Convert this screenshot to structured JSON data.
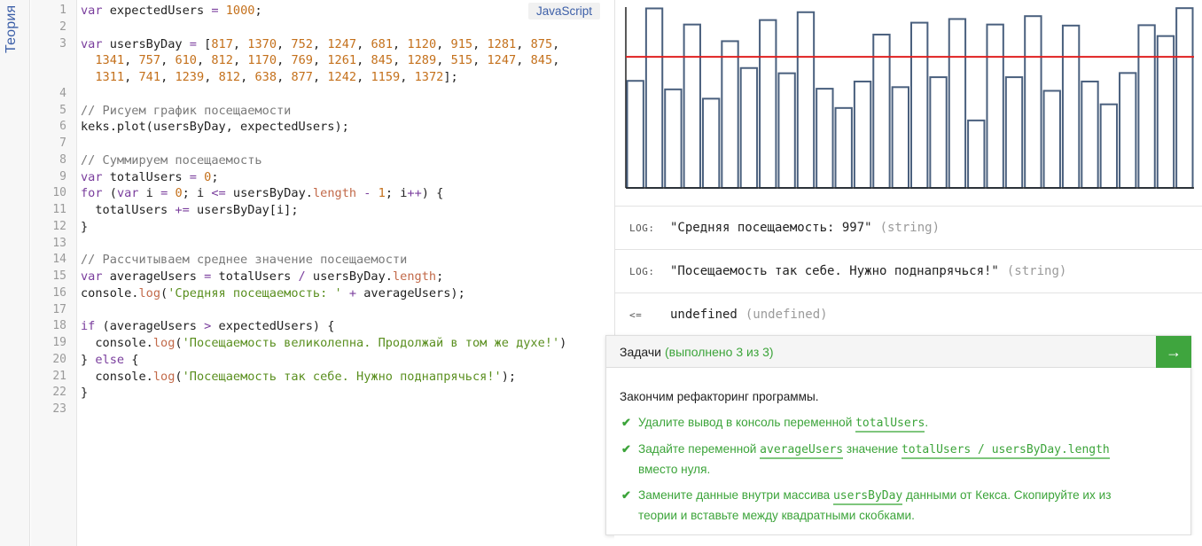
{
  "sidebar": {
    "theory_label": "Теория"
  },
  "editor": {
    "language": "JavaScript",
    "lines": [
      [
        [
          "kw",
          "var"
        ],
        [
          "",
          " expectedUsers "
        ],
        [
          "op",
          "="
        ],
        [
          "",
          " "
        ],
        [
          "num",
          "1000"
        ],
        [
          "",
          ";"
        ]
      ],
      [],
      [
        [
          "kw",
          "var"
        ],
        [
          "",
          " usersByDay "
        ],
        [
          "op",
          "="
        ],
        [
          "",
          " ["
        ],
        [
          "num",
          "817"
        ],
        [
          "",
          ", "
        ],
        [
          "num",
          "1370"
        ],
        [
          "",
          ", "
        ],
        [
          "num",
          "752"
        ],
        [
          "",
          ", "
        ],
        [
          "num",
          "1247"
        ],
        [
          "",
          ", "
        ],
        [
          "num",
          "681"
        ],
        [
          "",
          ", "
        ],
        [
          "num",
          "1120"
        ],
        [
          "",
          ", "
        ],
        [
          "num",
          "915"
        ],
        [
          "",
          ", "
        ],
        [
          "num",
          "1281"
        ],
        [
          "",
          ", "
        ],
        [
          "num",
          "875"
        ],
        [
          "",
          ","
        ]
      ],
      [
        [
          "",
          "  "
        ],
        [
          "num",
          "1341"
        ],
        [
          "",
          ", "
        ],
        [
          "num",
          "757"
        ],
        [
          "",
          ", "
        ],
        [
          "num",
          "610"
        ],
        [
          "",
          ", "
        ],
        [
          "num",
          "812"
        ],
        [
          "",
          ", "
        ],
        [
          "num",
          "1170"
        ],
        [
          "",
          ", "
        ],
        [
          "num",
          "769"
        ],
        [
          "",
          ", "
        ],
        [
          "num",
          "1261"
        ],
        [
          "",
          ", "
        ],
        [
          "num",
          "845"
        ],
        [
          "",
          ", "
        ],
        [
          "num",
          "1289"
        ],
        [
          "",
          ", "
        ],
        [
          "num",
          "515"
        ],
        [
          "",
          ", "
        ],
        [
          "num",
          "1247"
        ],
        [
          "",
          ", "
        ],
        [
          "num",
          "845"
        ],
        [
          "",
          ","
        ]
      ],
      [
        [
          "",
          "  "
        ],
        [
          "num",
          "1311"
        ],
        [
          "",
          ", "
        ],
        [
          "num",
          "741"
        ],
        [
          "",
          ", "
        ],
        [
          "num",
          "1239"
        ],
        [
          "",
          ", "
        ],
        [
          "num",
          "812"
        ],
        [
          "",
          ", "
        ],
        [
          "num",
          "638"
        ],
        [
          "",
          ", "
        ],
        [
          "num",
          "877"
        ],
        [
          "",
          ", "
        ],
        [
          "num",
          "1242"
        ],
        [
          "",
          ", "
        ],
        [
          "num",
          "1159"
        ],
        [
          "",
          ", "
        ],
        [
          "num",
          "1372"
        ],
        [
          "",
          "];"
        ]
      ],
      [],
      [
        [
          "com",
          "// Рисуем график посещаемости"
        ]
      ],
      [
        [
          "",
          "keks.plot(usersByDay, expectedUsers);"
        ]
      ],
      [],
      [
        [
          "com",
          "// Суммируем посещаемость"
        ]
      ],
      [
        [
          "kw",
          "var"
        ],
        [
          "",
          " totalUsers "
        ],
        [
          "op",
          "="
        ],
        [
          "",
          " "
        ],
        [
          "num",
          "0"
        ],
        [
          "",
          ";"
        ]
      ],
      [
        [
          "kw",
          "for"
        ],
        [
          "",
          " ("
        ],
        [
          "kw",
          "var"
        ],
        [
          "",
          " i "
        ],
        [
          "op",
          "="
        ],
        [
          "",
          " "
        ],
        [
          "num",
          "0"
        ],
        [
          "",
          "; i "
        ],
        [
          "op",
          "<="
        ],
        [
          "",
          " usersByDay."
        ],
        [
          "prop",
          "length"
        ],
        [
          "",
          " "
        ],
        [
          "op",
          "-"
        ],
        [
          "",
          " "
        ],
        [
          "num",
          "1"
        ],
        [
          "",
          "; i"
        ],
        [
          "op",
          "++"
        ],
        [
          "",
          ") {"
        ]
      ],
      [
        [
          "",
          "  totalUsers "
        ],
        [
          "op",
          "+="
        ],
        [
          "",
          " usersByDay[i];"
        ]
      ],
      [
        [
          "",
          "}"
        ]
      ],
      [],
      [
        [
          "com",
          "// Рассчитываем среднее значение посещаемости"
        ]
      ],
      [
        [
          "kw",
          "var"
        ],
        [
          "",
          " averageUsers "
        ],
        [
          "op",
          "="
        ],
        [
          "",
          " totalUsers "
        ],
        [
          "op",
          "/"
        ],
        [
          "",
          " usersByDay."
        ],
        [
          "prop",
          "length"
        ],
        [
          "",
          ";"
        ]
      ],
      [
        [
          "",
          "console."
        ],
        [
          "prop",
          "log"
        ],
        [
          "",
          "("
        ],
        [
          "str",
          "'Средняя посещаемость: '"
        ],
        [
          "",
          " "
        ],
        [
          "op",
          "+"
        ],
        [
          "",
          " averageUsers);"
        ]
      ],
      [],
      [
        [
          "kw",
          "if"
        ],
        [
          "",
          " (averageUsers "
        ],
        [
          "op",
          ">"
        ],
        [
          "",
          " expectedUsers) {"
        ]
      ],
      [
        [
          "",
          "  console."
        ],
        [
          "prop",
          "log"
        ],
        [
          "",
          "("
        ],
        [
          "str",
          "'Посещаемость великолепна. Продолжай в том же духе!'"
        ],
        [
          "",
          ")"
        ]
      ],
      [
        [
          "",
          "} "
        ],
        [
          "kw",
          "else"
        ],
        [
          "",
          " {"
        ]
      ],
      [
        [
          "",
          "  console."
        ],
        [
          "prop",
          "log"
        ],
        [
          "",
          "("
        ],
        [
          "str",
          "'Посещаемость так себе. Нужно поднапрячься!'"
        ],
        [
          "",
          ");"
        ]
      ],
      [
        [
          "",
          "}"
        ]
      ],
      []
    ],
    "line_numbers": [
      "1",
      "2",
      "3",
      "",
      "",
      "4",
      "5",
      "6",
      "7",
      "8",
      "9",
      "10",
      "11",
      "12",
      "13",
      "14",
      "15",
      "16",
      "17",
      "18",
      "19",
      "20",
      "21",
      "22",
      "23"
    ]
  },
  "chart_data": {
    "type": "bar",
    "style": "outlined",
    "bar_color": "#4a607e",
    "threshold_color": "#e02020",
    "values": [
      817,
      1370,
      752,
      1247,
      681,
      1120,
      915,
      1281,
      875,
      1341,
      757,
      610,
      812,
      1170,
      769,
      1261,
      845,
      1289,
      515,
      1247,
      845,
      1311,
      741,
      1239,
      812,
      638,
      877,
      1242,
      1159,
      1372
    ],
    "threshold": 1000,
    "ylim": [
      0,
      1380
    ],
    "grid": false
  },
  "console": [
    {
      "tag": "LOG:",
      "value": "\"Средняя посещаемость: 997\"",
      "type": "(string)"
    },
    {
      "tag": "LOG:",
      "value": "\"Посещаемость так себе. Нужно поднапрячься!\"",
      "type": "(string)"
    },
    {
      "tag": "<=",
      "value": "undefined",
      "type": "(undefined)"
    }
  ],
  "tasks": {
    "title": "Задачи",
    "progress": "(выполнено 3 из 3)",
    "next_icon": "arrow-right-icon",
    "intro": "Закончим рефакторинг программы.",
    "items": [
      {
        "parts": [
          [
            "t",
            "Удалите вывод в консоль переменной "
          ],
          [
            "c",
            "totalUsers"
          ],
          [
            "t",
            "."
          ]
        ]
      },
      {
        "parts": [
          [
            "t",
            "Задайте переменной "
          ],
          [
            "c",
            "averageUsers"
          ],
          [
            "t",
            " значение "
          ],
          [
            "c",
            "totalUsers / usersByDay.length"
          ],
          [
            "t",
            " вместо нуля."
          ]
        ]
      },
      {
        "parts": [
          [
            "t",
            "Замените данные внутри массива "
          ],
          [
            "c",
            "usersByDay"
          ],
          [
            "t",
            " данными от Кекса. Скопируйте их из теории и вставьте между квадратными скобками."
          ]
        ]
      }
    ]
  },
  "colors": {
    "accent_green": "#3fa53e",
    "link_blue": "#3c5fa8"
  }
}
